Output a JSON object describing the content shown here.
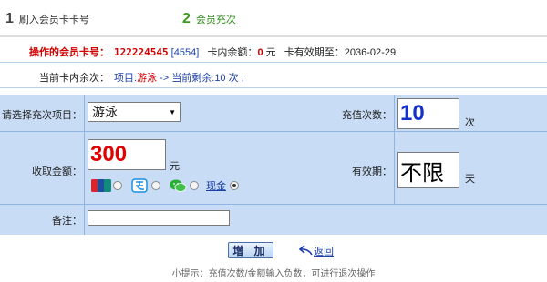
{
  "steps": [
    {
      "number": "1",
      "label": "刷入会员卡卡号"
    },
    {
      "number": "2",
      "label": "会员充次"
    }
  ],
  "info": {
    "card_label": "操作的会员卡号：",
    "card_no": "122224545",
    "card_id": "[4554]",
    "balance_label": "卡内余额：",
    "balance_value": "0",
    "balance_unit": "元",
    "expiry_text": "卡有效期至：2036-02-29",
    "remaining_label": "当前卡内余次：",
    "project_prefix": "项目:",
    "project_name": "游泳",
    "remaining_text": " -> 当前剩余:10 次 ;"
  },
  "form": {
    "project_label": "请选择充次项目：",
    "project_selected": "游泳",
    "count_label": "充值次数：",
    "count_value": "10",
    "count_unit": "次",
    "amount_label": "收取金额：",
    "amount_value": "300",
    "amount_unit": "元",
    "validity_label": "有效期：",
    "validity_value": "不限",
    "validity_unit": "天",
    "payment_methods": [
      {
        "name": "unionpay",
        "checked": false
      },
      {
        "name": "alipay",
        "checked": false
      },
      {
        "name": "wechat",
        "checked": false
      },
      {
        "name": "cash",
        "label": "现金",
        "checked": true
      }
    ],
    "remark_label": "备注：",
    "remark_value": ""
  },
  "actions": {
    "add_label": "增 加",
    "back_label": "返回"
  },
  "tip": "小提示：充值次数/金额输入负数，可进行退次操作",
  "colors": {
    "form_bg": "#c8dcf5",
    "accent_red": "#d00000",
    "link_blue": "#1d3fa8",
    "step_green": "#3a9a1e"
  }
}
